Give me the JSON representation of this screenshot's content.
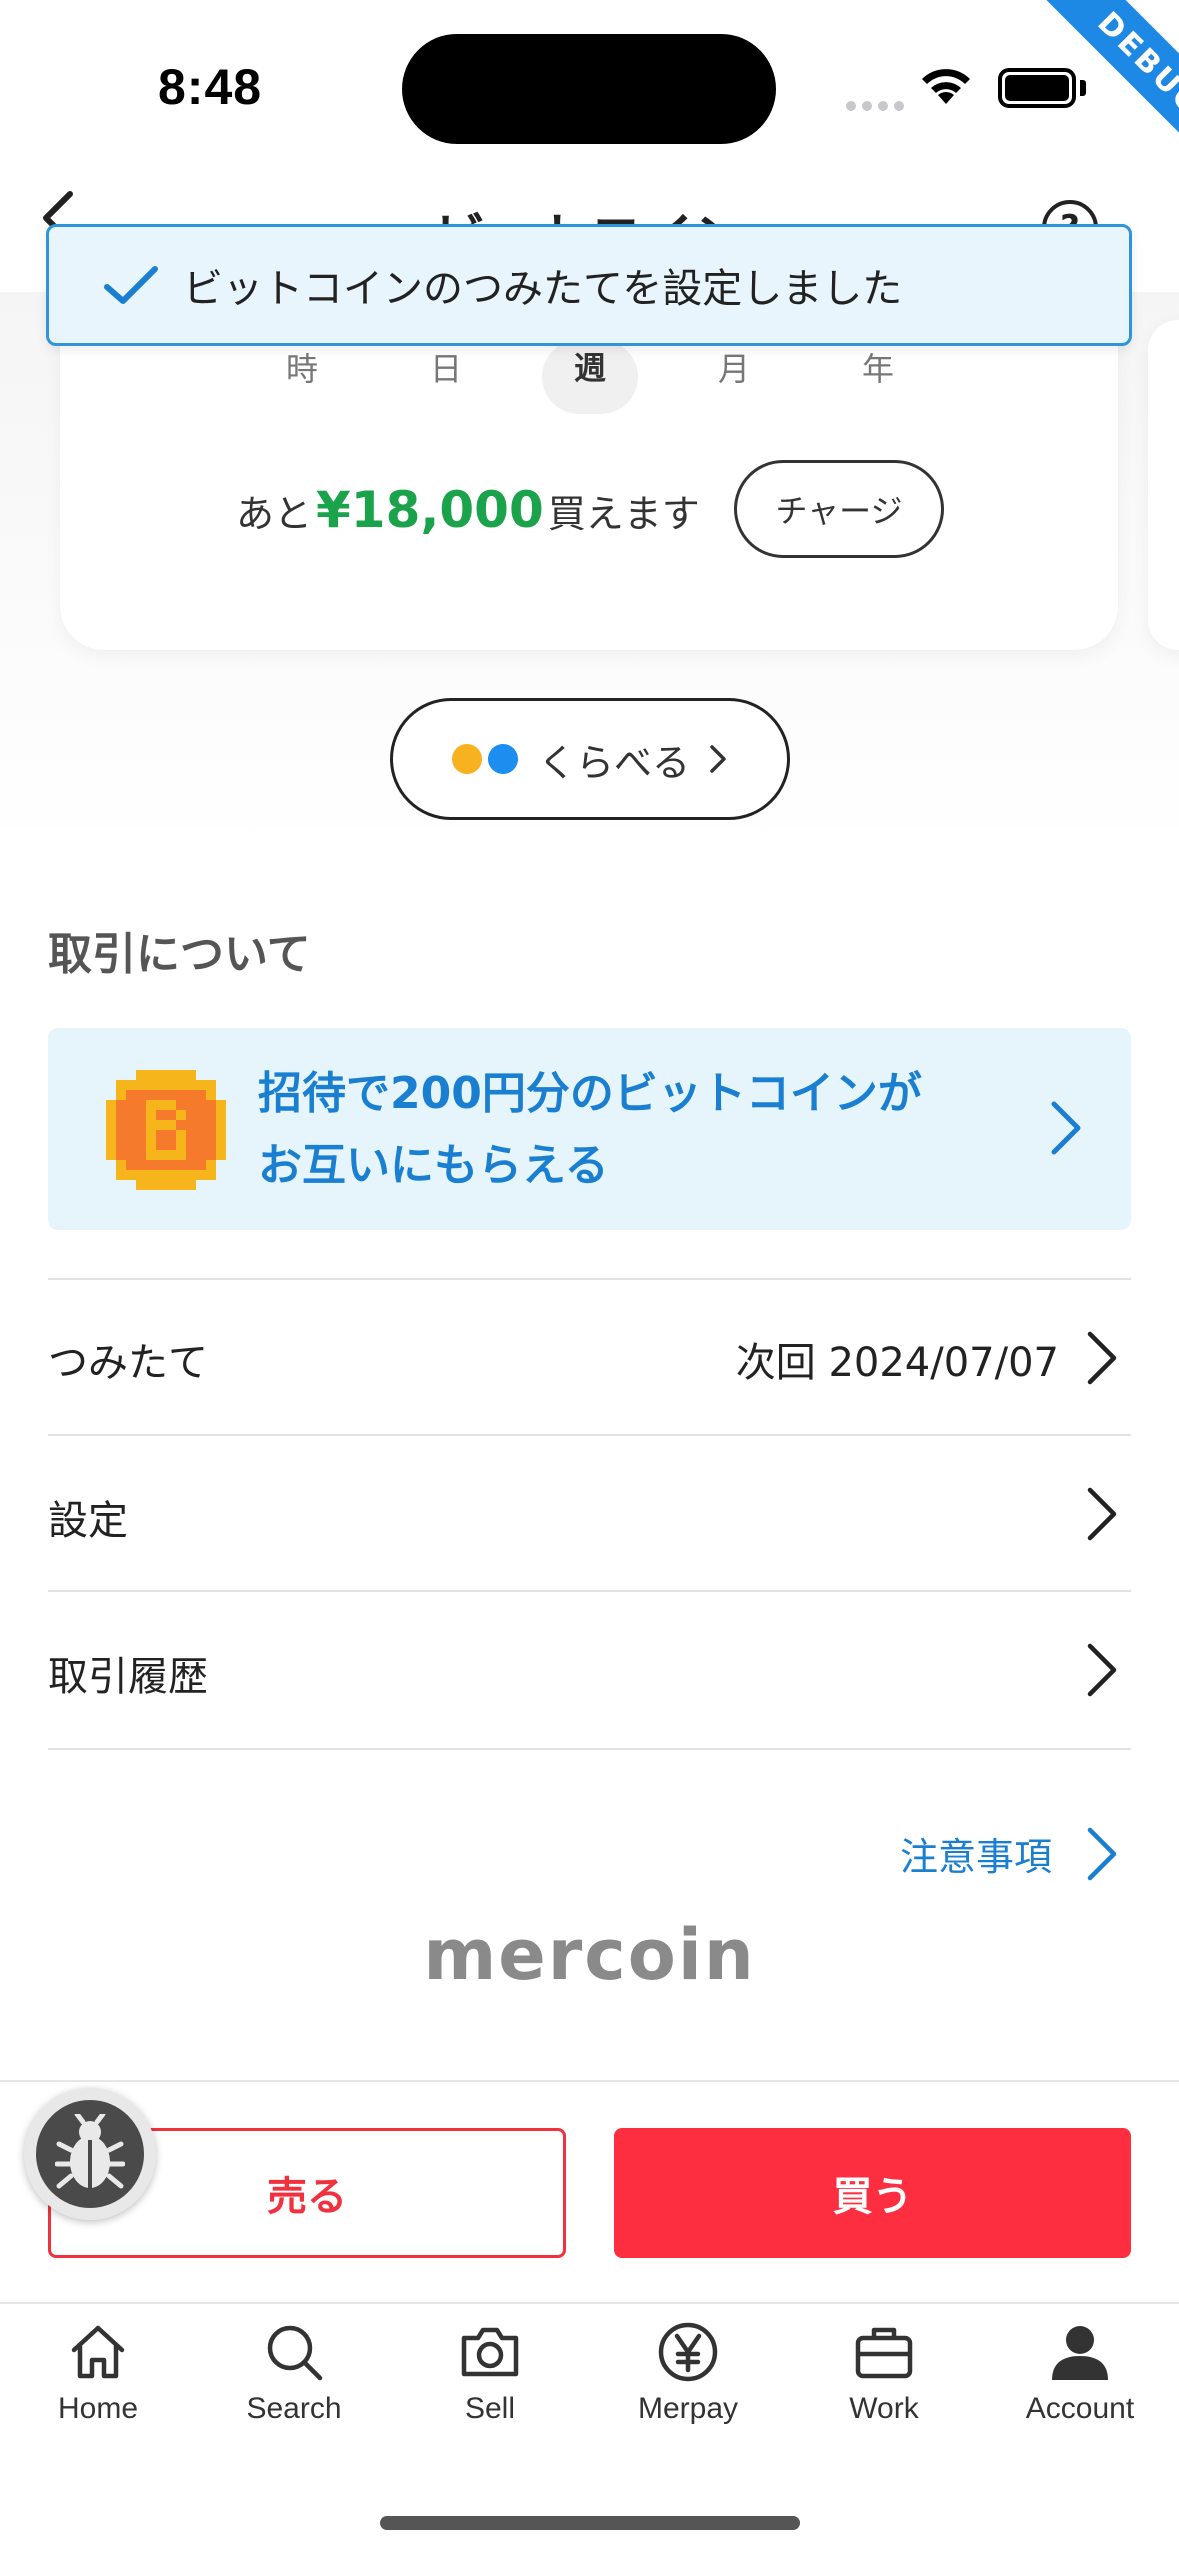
{
  "status_bar": {
    "time": "8:48"
  },
  "debug_ribbon": "DEBUG",
  "header": {
    "title": "ビットコイン",
    "help": "?"
  },
  "toast": {
    "message": "ビットコインのつみたてを設定しました"
  },
  "chart_card": {
    "periods": [
      "時",
      "日",
      "週",
      "月",
      "年"
    ],
    "selected_period": "週",
    "available_prefix": "あと",
    "available_amount": "¥18,000",
    "available_suffix": "買えます",
    "charge_label": "チャージ"
  },
  "compare": {
    "label": "くらべる"
  },
  "section": {
    "title": "取引について"
  },
  "invite_banner": {
    "line1": "招待で200円分のビットコインが",
    "line2": "お互いにもらえる"
  },
  "rows": [
    {
      "label": "つみたて",
      "value": "次回 2024/07/07"
    },
    {
      "label": "設定",
      "value": ""
    },
    {
      "label": "取引履歴",
      "value": ""
    }
  ],
  "notice": {
    "label": "注意事項"
  },
  "brand": {
    "name": "mercoin"
  },
  "actions": {
    "sell": "売る",
    "buy": "買う"
  },
  "tabs": [
    {
      "label": "Home",
      "icon": "home-icon"
    },
    {
      "label": "Search",
      "icon": "search-icon"
    },
    {
      "label": "Sell",
      "icon": "camera-icon"
    },
    {
      "label": "Merpay",
      "icon": "yen-icon"
    },
    {
      "label": "Work",
      "icon": "briefcase-icon"
    },
    {
      "label": "Account",
      "icon": "person-icon"
    }
  ],
  "colors": {
    "accent_blue": "#1b7fd1",
    "green_amount": "#1aa34a",
    "buy_red": "#fd2e3f",
    "toast_border": "#2f95db"
  }
}
